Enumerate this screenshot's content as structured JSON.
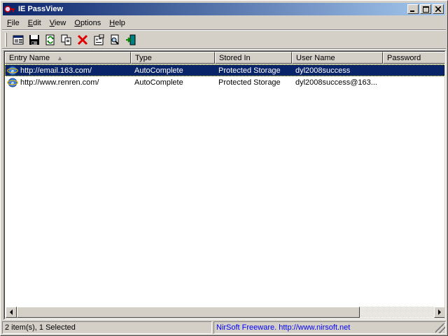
{
  "window": {
    "title": "IE PassView",
    "minimize_label": "_",
    "maximize_label": "□",
    "close_label": "✕"
  },
  "menu": [
    {
      "label": "File",
      "accel": "F",
      "rest": "ile"
    },
    {
      "label": "Edit",
      "accel": "E",
      "rest": "dit"
    },
    {
      "label": "View",
      "accel": "V",
      "rest": "iew"
    },
    {
      "label": "Options",
      "accel": "O",
      "rest": "ptions"
    },
    {
      "label": "Help",
      "accel": "H",
      "rest": "elp"
    }
  ],
  "toolbar": {
    "buttons": [
      {
        "name": "html-report-icon"
      },
      {
        "name": "save-icon"
      },
      {
        "name": "refresh-icon"
      },
      {
        "name": "copy-icon"
      },
      {
        "name": "delete-icon"
      },
      {
        "name": "properties-icon"
      },
      {
        "name": "find-icon"
      },
      {
        "name": "exit-icon"
      }
    ]
  },
  "list": {
    "columns": [
      "Entry Name",
      "Type",
      "Stored In",
      "User Name",
      "Password"
    ],
    "sort_column": "Entry Name",
    "rows": [
      {
        "entry": "http://email.163.com/",
        "type": "AutoComplete",
        "stored_in": "Protected Storage",
        "user": "dyl2008success",
        "password": "",
        "selected": true
      },
      {
        "entry": "http://www.renren.com/",
        "type": "AutoComplete",
        "stored_in": "Protected Storage",
        "user": "dyl2008success@163...",
        "password": "",
        "selected": false
      }
    ]
  },
  "status": {
    "count_text": "2 item(s), 1 Selected",
    "credit_text": "NirSoft Freeware.  http://www.nirsoft.net"
  },
  "colors": {
    "title_bar": "#0a246a",
    "selection": "#0a246a",
    "link": "#0000ff"
  }
}
